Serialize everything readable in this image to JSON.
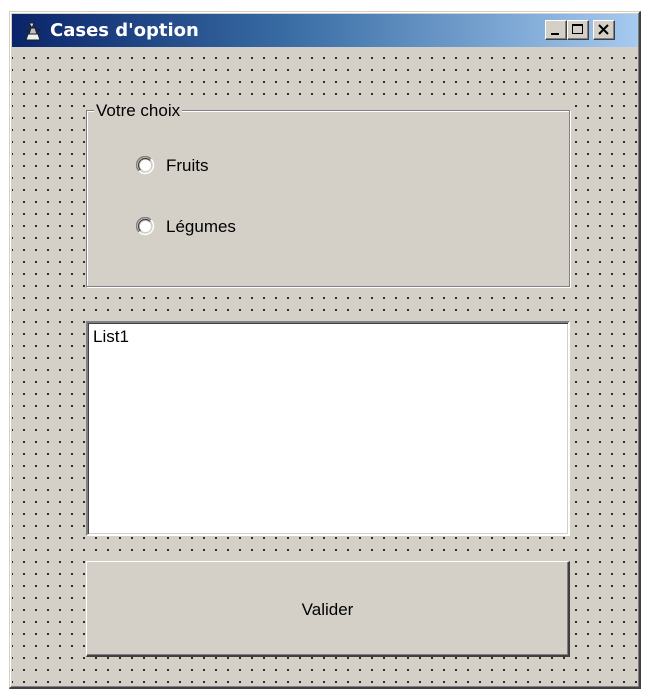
{
  "window": {
    "title": "Cases d'option",
    "icon": "app-icon",
    "controls": [
      "minimize-icon",
      "maximize-icon",
      "close-icon"
    ]
  },
  "groupbox": {
    "legend": "Votre choix",
    "options": [
      {
        "label": "Fruits",
        "selected": false
      },
      {
        "label": "Légumes",
        "selected": false
      }
    ]
  },
  "listbox": {
    "items": [
      "List1"
    ]
  },
  "button": {
    "label": "Valider"
  },
  "colors": {
    "face": "#d4d0c8",
    "title_start": "#0a246a",
    "title_end": "#a6caf0",
    "grid_dot": "#000000"
  }
}
